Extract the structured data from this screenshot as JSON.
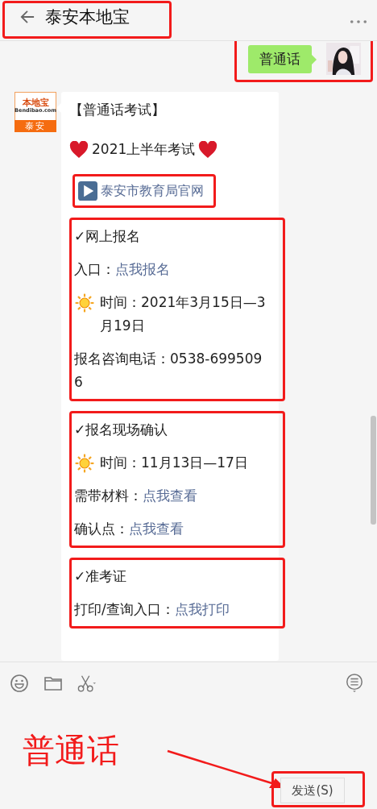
{
  "header": {
    "title": "泰安本地宝"
  },
  "sent_message": {
    "text": "普通话"
  },
  "received_message": {
    "avatar": {
      "brand": "本地宝",
      "site": "Bendibao.com",
      "city": "泰安"
    },
    "blocks": [
      {
        "kind": "text",
        "text": "【普通话考试】"
      },
      {
        "kind": "hearts",
        "text": "2021上半年考试"
      },
      {
        "kind": "link",
        "text": "泰安市教育局官网"
      },
      {
        "kind": "section",
        "title": "✓网上报名",
        "lines": [
          {
            "kind": "link_line",
            "label": "入口：",
            "link": "点我报名"
          },
          {
            "kind": "sun_line",
            "text": "时间：2021年3月15日—3月19日"
          },
          {
            "kind": "plain",
            "text": "报名咨询电话：0538-6995096"
          }
        ]
      },
      {
        "kind": "section",
        "title": "✓报名现场确认",
        "lines": [
          {
            "kind": "sun_line",
            "text": "时间：11月13日—17日"
          },
          {
            "kind": "link_line",
            "label": "需带材料：",
            "link": "点我查看"
          },
          {
            "kind": "link_line",
            "label": "确认点：",
            "link": "点我查看"
          }
        ]
      },
      {
        "kind": "section",
        "title": "✓准考证",
        "lines": [
          {
            "kind": "link_line",
            "label": "打印/查询入口：",
            "link": "点我打印"
          }
        ]
      }
    ]
  },
  "annotation": {
    "text": "普通话"
  },
  "send_button": {
    "label": "发送(S)"
  }
}
